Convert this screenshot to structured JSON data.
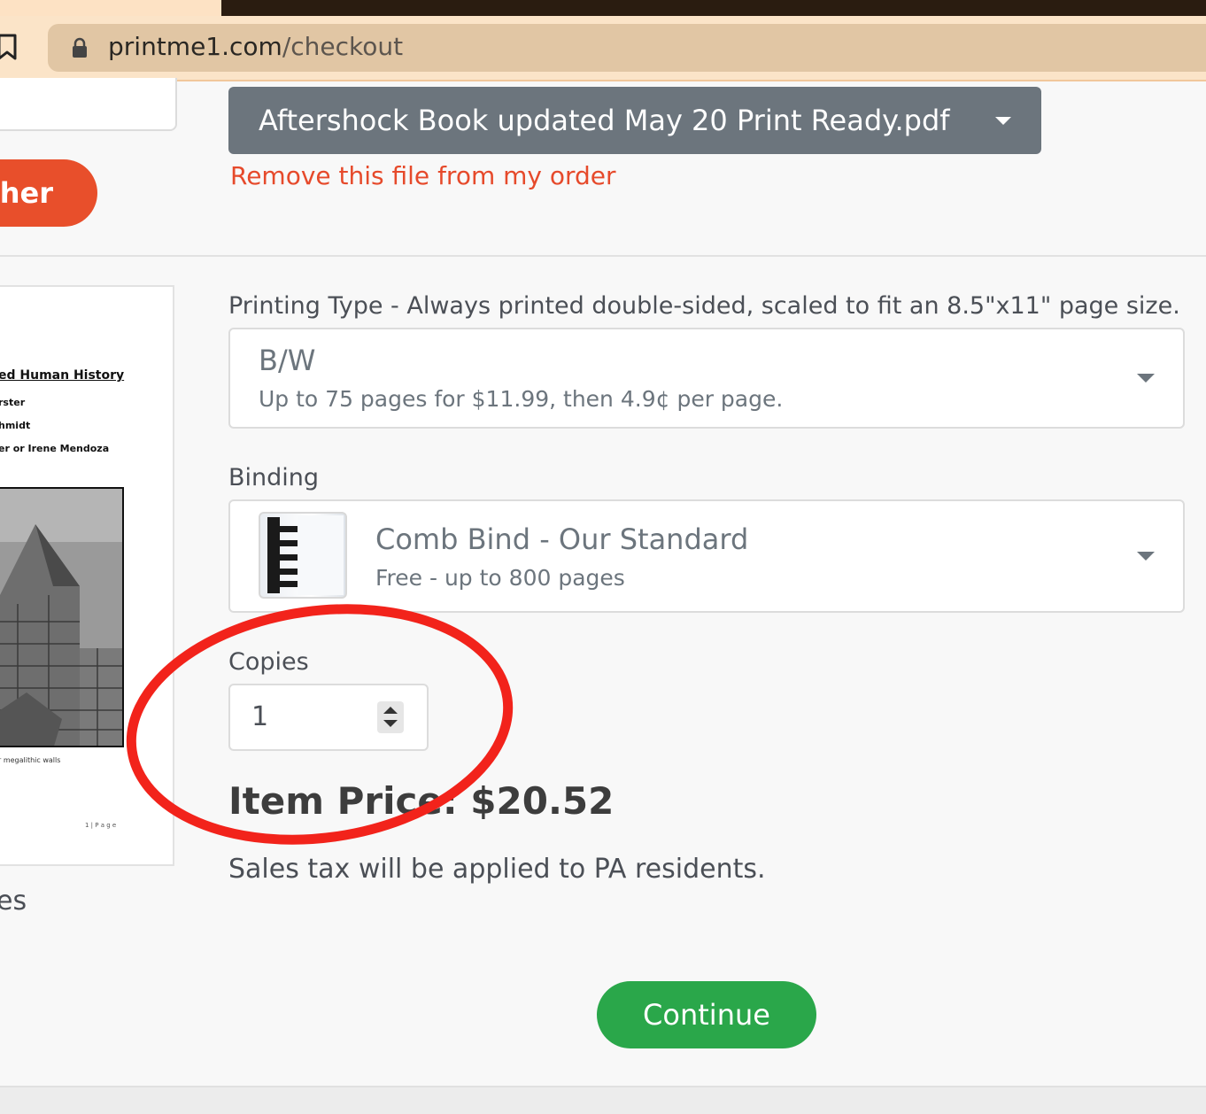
{
  "browser": {
    "url_domain": "printme1.com",
    "url_path": "/checkout",
    "icons": {
      "bookmark": "bookmark-icon",
      "lock": "lock-icon"
    }
  },
  "left_panel": {
    "voucher_button_label": "cher",
    "preview_lines": [
      "ed Human History",
      "rster",
      "hmidt",
      "er or Irene Mendoza"
    ],
    "preview_caption": "r megalithic walls",
    "preview_page_number": "1 | P a g e",
    "pages_text": "es"
  },
  "file": {
    "name": "Aftershock Book updated May 20 Print Ready.pdf",
    "remove_label": "Remove this file from my order"
  },
  "printing_type": {
    "label": "Printing Type - Always printed double-sided, scaled to fit an 8.5\"x11\" page size.",
    "selected_title": "B/W",
    "selected_subtitle": "Up to 75 pages for $11.99, then 4.9¢ per page."
  },
  "binding": {
    "label": "Binding",
    "selected_title": "Comb Bind - Our Standard",
    "selected_subtitle": "Free - up to 800 pages"
  },
  "copies": {
    "label": "Copies",
    "value": "1"
  },
  "price": {
    "text": "Item Price: $20.52"
  },
  "tax_note": "Sales tax will be applied to PA residents.",
  "continue_label": "Continue",
  "colors": {
    "accent_orange": "#e84f2b",
    "continue_green": "#2aa74a",
    "dropdown_gray": "#6c757d",
    "annotation_red": "#f2231b"
  }
}
